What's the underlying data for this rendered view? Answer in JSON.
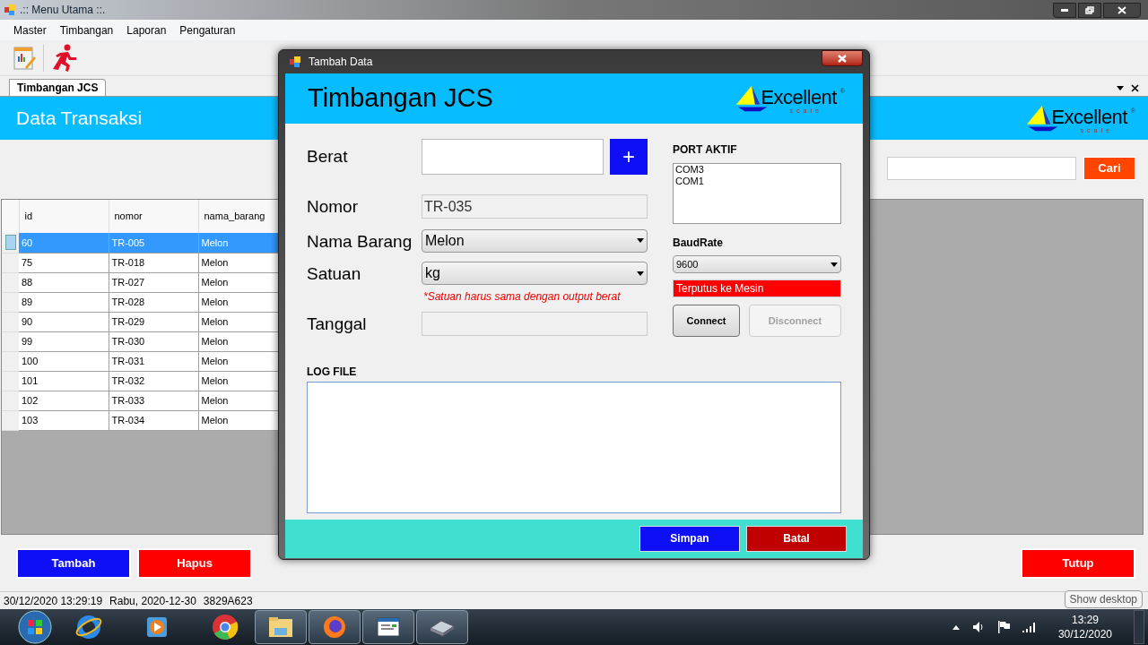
{
  "main_window": {
    "title": ".:: Menu Utama ::.",
    "menu": [
      "Master",
      "Timbangan",
      "Laporan",
      "Pengaturan"
    ],
    "tabs": [
      {
        "label": "Timbangan JCS",
        "selected": true
      }
    ],
    "header": "Data Transaksi",
    "logo": {
      "name": "Excellent",
      "tagline": "scale",
      "mark": "®"
    },
    "search": {
      "button": "Cari"
    },
    "table": {
      "columns": [
        "id",
        "nomor",
        "nama_barang"
      ],
      "rows": [
        {
          "cells": [
            "60",
            "TR-005",
            "Melon"
          ],
          "selected": true
        },
        {
          "cells": [
            "75",
            "TR-018",
            "Melon"
          ],
          "selected": false
        },
        {
          "cells": [
            "88",
            "TR-027",
            "Melon"
          ],
          "selected": false
        },
        {
          "cells": [
            "89",
            "TR-028",
            "Melon"
          ],
          "selected": false
        },
        {
          "cells": [
            "90",
            "TR-029",
            "Melon"
          ],
          "selected": false
        },
        {
          "cells": [
            "99",
            "TR-030",
            "Melon"
          ],
          "selected": false
        },
        {
          "cells": [
            "100",
            "TR-031",
            "Melon"
          ],
          "selected": false
        },
        {
          "cells": [
            "101",
            "TR-032",
            "Melon"
          ],
          "selected": false
        },
        {
          "cells": [
            "102",
            "TR-033",
            "Melon"
          ],
          "selected": false
        },
        {
          "cells": [
            "103",
            "TR-034",
            "Melon"
          ],
          "selected": false
        }
      ]
    },
    "buttons": [
      {
        "label": "Tambah",
        "kind": "primary"
      },
      {
        "label": "Hapus",
        "kind": "danger"
      },
      {
        "label": "Tutup",
        "kind": "danger"
      }
    ],
    "status_bar": [
      "30/12/2020 13:29:19",
      "Rabu, 2020-12-30",
      "3829A623"
    ]
  },
  "dialog": {
    "title": "Tambah Data",
    "header": "Timbangan JCS",
    "logo": {
      "name": "Excellent",
      "tagline": "scale",
      "mark": "®"
    },
    "fields": [
      {
        "label": "Berat",
        "kind": "input"
      },
      {
        "label": "Nomor",
        "kind": "readonly",
        "value": "TR-035"
      },
      {
        "label": "Nama Barang",
        "kind": "select",
        "value": "Melon"
      },
      {
        "label": "Satuan",
        "kind": "select",
        "value": "kg",
        "note": "*Satuan harus sama dengan output berat"
      },
      {
        "label": "Tanggal",
        "kind": "readonly"
      }
    ],
    "add_button": "+",
    "port": {
      "label": "PORT AKTIF",
      "items": [
        "COM3",
        "COM1"
      ]
    },
    "baud": {
      "label": "BaudRate",
      "value": "9600"
    },
    "connection_status": "Terputus ke Mesin",
    "connect_buttons": [
      {
        "label": "Connect",
        "disabled": false
      },
      {
        "label": "Disconnect",
        "disabled": true
      }
    ],
    "log": {
      "label": "LOG FILE"
    },
    "buttons": [
      {
        "label": "Simpan",
        "kind": "primary"
      },
      {
        "label": "Batal",
        "kind": "cancel"
      }
    ]
  },
  "taskbar": {
    "tooltip": "Show desktop",
    "clock": {
      "time": "13:29",
      "date": "30/12/2020"
    }
  }
}
